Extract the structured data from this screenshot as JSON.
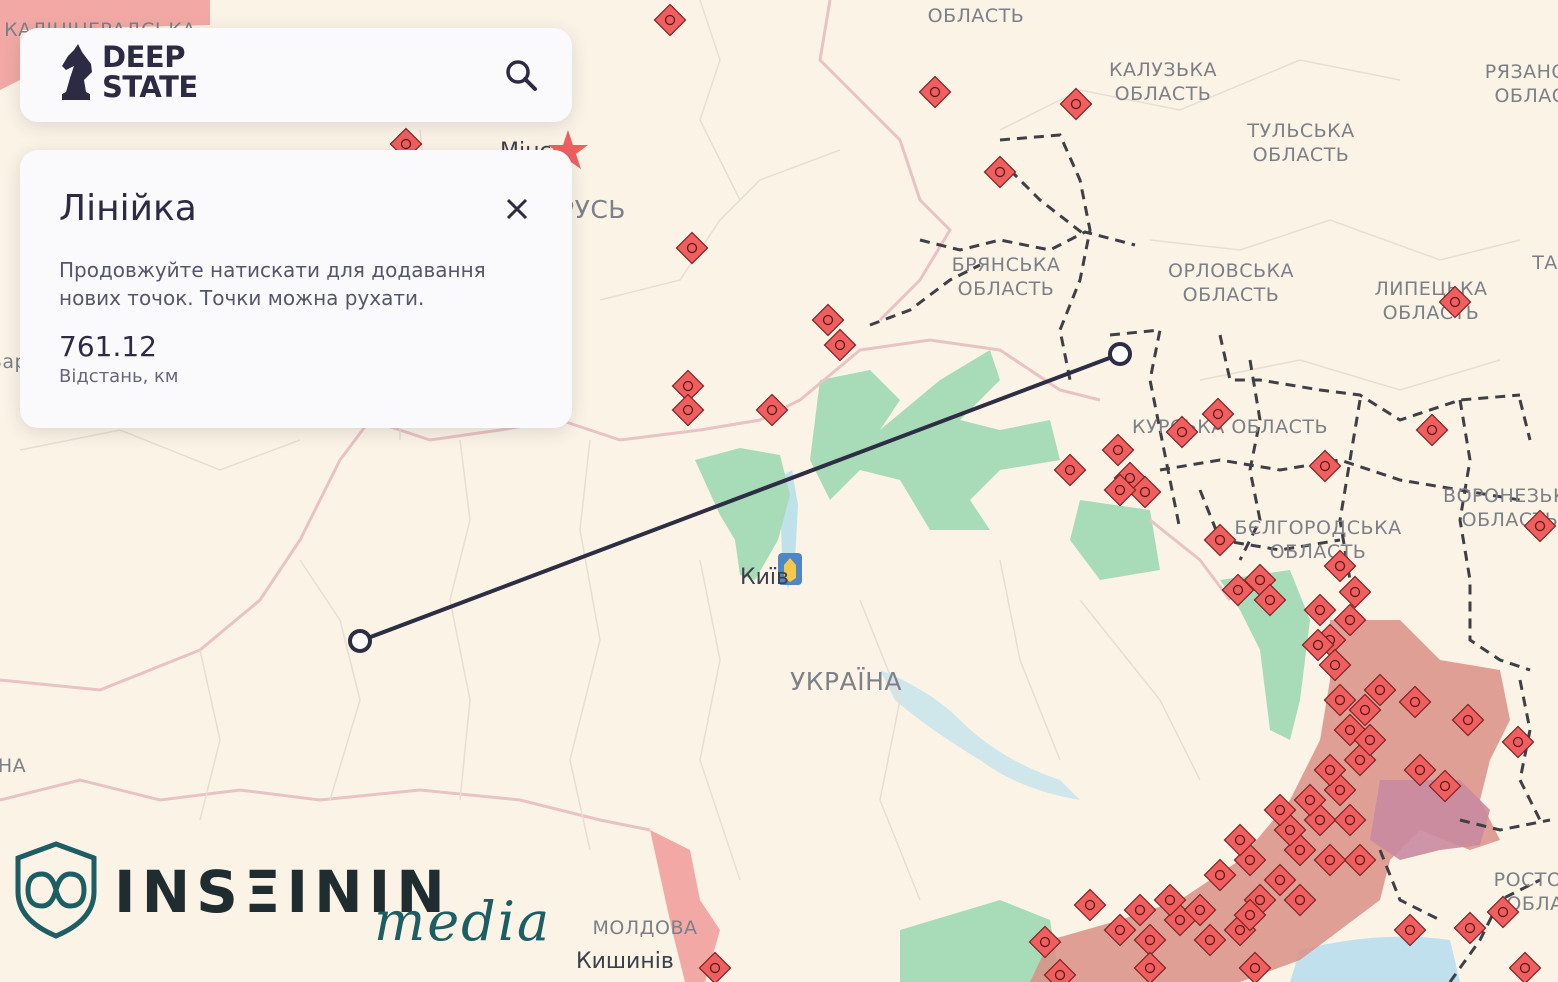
{
  "brand": {
    "line1": "DEEP",
    "line2": "STATE",
    "logo_icon": "knight-chess-icon"
  },
  "search": {
    "icon": "search-icon"
  },
  "ruler_panel": {
    "title": "Лінійка",
    "hint": "Продовжуйте натискати для додавання нових точок. Точки можна рухати.",
    "distance_value": "761.12",
    "distance_label": "Відстань, км",
    "close_icon": "close-icon"
  },
  "map": {
    "labels": {
      "kaluzka": [
        "КАЛУЗЬКА",
        "ОБЛАСТЬ"
      ],
      "tulska": [
        "ТУЛЬСЬКА",
        "ОБЛАСТЬ"
      ],
      "ryazan": [
        "РЯЗАНС",
        "ОБЛАС"
      ],
      "bryanska": [
        "БРЯНСЬКА",
        "ОБЛАСТЬ"
      ],
      "orlovska": [
        "ОРЛОВСЬКА",
        "ОБЛАСТЬ"
      ],
      "lipetska": [
        "ЛИПЕЦЬКА",
        "ОБЛАСТЬ"
      ],
      "kurska": "КУРСЬКА ОБЛАСТЬ",
      "belgorodska": [
        "БЄЛГОРОДСЬКА",
        "ОБЛАСТЬ"
      ],
      "voronezka": [
        "ВОРОНЕЗЬК",
        "ОБЛАСТЬ"
      ],
      "rostov": [
        "РОСТО",
        "ОБЛА"
      ],
      "top_oblast": "ОБЛАСТЬ",
      "belarus": "БІЛОРУСЬ",
      "ukraine": "УКРАЇНА",
      "moldova": "МОЛДОВА",
      "kaliningrad": "КАЛІНІНГРАДСЬКА",
      "tambov_partial": "ТА",
      "left_partial_1": "Вар",
      "left_partial_2": "НА"
    },
    "cities": {
      "kyiv": "Київ",
      "chisinau": "Кишинів",
      "minsk": "Мінськ"
    },
    "ruler_points": [
      "start-point",
      "end-point"
    ],
    "colors": {
      "background": "#fbf3e6",
      "occupied": "#d98f86",
      "occupied_dark": "#c97a89",
      "liberated": "#a8dcb8",
      "marker": "#ef5f5f",
      "ruler_line": "#2d2d44",
      "border": "#e6b7b9"
    }
  },
  "watermark": {
    "text": "INSΞININ",
    "sub": "media",
    "icon": "infinity-shield-icon"
  }
}
